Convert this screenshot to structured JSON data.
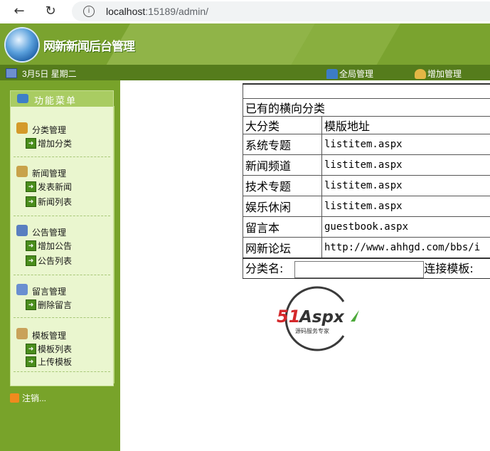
{
  "browser": {
    "url_host": "localhost",
    "url_rest": ":15189/admin/"
  },
  "banner": {
    "title": "网新新闻后台管理"
  },
  "topnav": {
    "date": "3月5日 星期二",
    "links": [
      "全局管理",
      "增加管理"
    ]
  },
  "sidebar": {
    "header": "功能菜单",
    "groups": [
      {
        "title": "分类管理",
        "items": [
          "增加分类"
        ]
      },
      {
        "title": "新闻管理",
        "items": [
          "发表新闻",
          "新闻列表"
        ]
      },
      {
        "title": "公告管理",
        "items": [
          "增加公告",
          "公告列表"
        ]
      },
      {
        "title": "留言管理",
        "items": [
          "删除留言"
        ]
      },
      {
        "title": "模板管理",
        "items": [
          "模板列表",
          "上传模板"
        ]
      }
    ],
    "logout": "注销..."
  },
  "category_table": {
    "caption": "已有的横向分类",
    "headers": [
      "大分类",
      "模版地址"
    ],
    "rows": [
      [
        "系统专题",
        "listitem.aspx"
      ],
      [
        "新闻频道",
        "listitem.aspx"
      ],
      [
        "技术专题",
        "listitem.aspx"
      ],
      [
        "娱乐休闲",
        "listitem.aspx"
      ],
      [
        "留言本",
        "guestbook.aspx"
      ],
      [
        "网新论坛",
        "http://www.ahhgd.com/bbs/i"
      ]
    ],
    "form": {
      "name_label": "分类名:",
      "name_value": "",
      "template_label": "连接模板:"
    }
  },
  "watermark": {
    "brand": "51Aspx",
    "tagline": "源码服务专家"
  },
  "colors": {
    "banner_green": "#7aa32f",
    "nav_green": "#557c1c",
    "menu_bg": "#eaf6cf"
  }
}
